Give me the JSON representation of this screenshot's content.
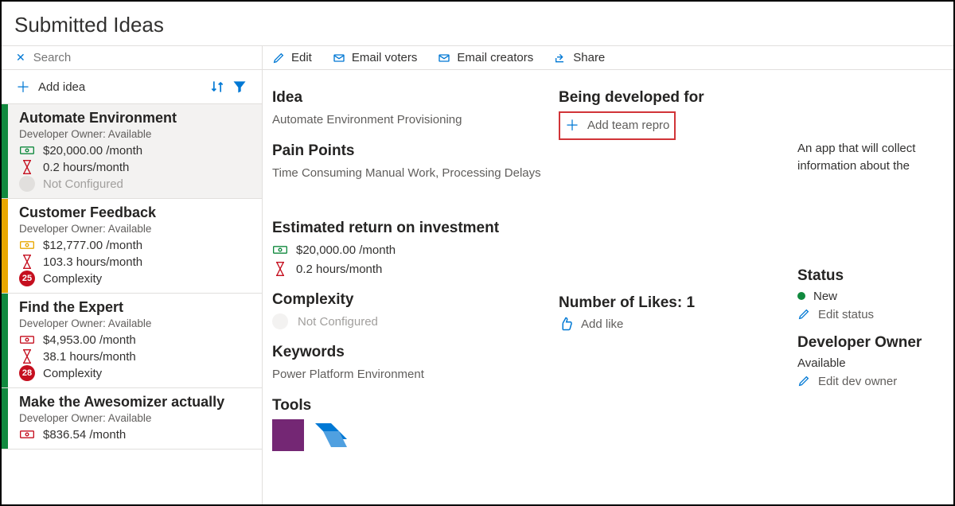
{
  "header": {
    "title": "Submitted Ideas"
  },
  "sidebar": {
    "search_placeholder": "Search",
    "add_idea_label": "Add idea",
    "items": [
      {
        "strip": "green",
        "title": "Automate Environment",
        "owner": "Developer Owner: Available",
        "cost": "$20,000.00 /month",
        "hours": "0.2 hours/month",
        "complexity_label": "Not Configured",
        "complexity_badge": null,
        "selected": true
      },
      {
        "strip": "yellow",
        "title": "Customer Feedback",
        "owner": "Developer Owner: Available",
        "cost": "$12,777.00 /month",
        "hours": "103.3 hours/month",
        "complexity_label": "Complexity",
        "complexity_badge": "25",
        "selected": false
      },
      {
        "strip": "green",
        "title": "Find the Expert",
        "owner": "Developer Owner: Available",
        "cost": "$4,953.00 /month",
        "hours": "38.1 hours/month",
        "complexity_label": "Complexity",
        "complexity_badge": "28",
        "selected": false
      },
      {
        "strip": "green",
        "title": "Make the Awesomizer actually",
        "owner": "Developer Owner: Available",
        "cost": "$836.54 /month",
        "hours": "",
        "complexity_label": "",
        "complexity_badge": null,
        "selected": false
      }
    ]
  },
  "toolbar": {
    "edit": "Edit",
    "email_voters": "Email voters",
    "email_creators": "Email creators",
    "share": "Share"
  },
  "detail": {
    "idea_h": "Idea",
    "idea_v": "Automate Environment Provisioning",
    "pain_h": "Pain Points",
    "pain_v": "Time Consuming Manual Work, Processing Delays",
    "roi_h": "Estimated return on investment",
    "roi_cost": "$20,000.00 /month",
    "roi_hours": "0.2 hours/month",
    "complexity_h": "Complexity",
    "complexity_v": "Not Configured",
    "keywords_h": "Keywords",
    "keywords_v": "Power Platform Environment",
    "tools_h": "Tools",
    "being_developed_h": "Being developed for",
    "add_team_label": "Add team repro",
    "likes_h": "Number of Likes: 1",
    "add_like_label": "Add like",
    "description": "An app that will collect information about the",
    "status_h": "Status",
    "status_v": "New",
    "edit_status": "Edit status",
    "dev_owner_h": "Developer Owner",
    "dev_owner_v": "Available",
    "edit_dev_owner": "Edit dev owner"
  }
}
